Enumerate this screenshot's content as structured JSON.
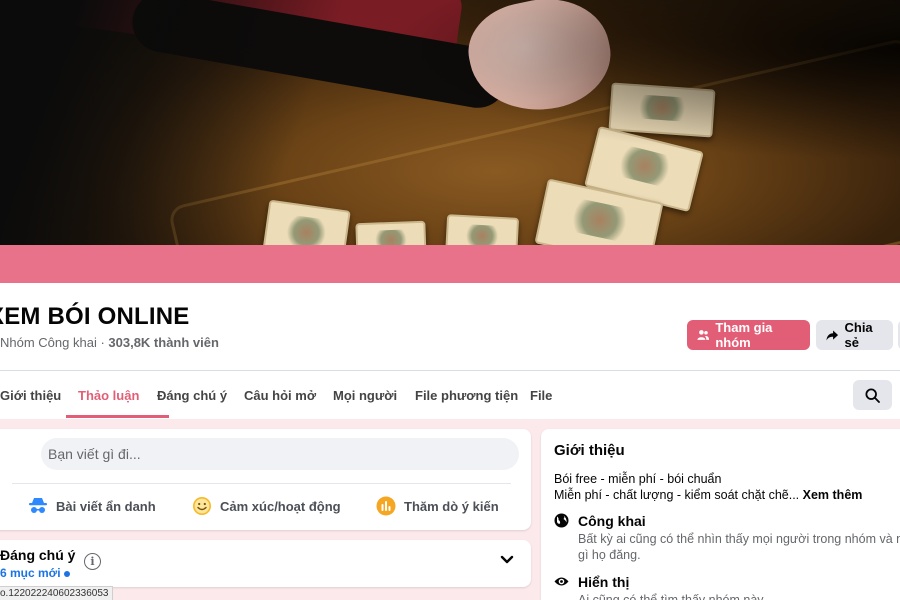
{
  "group": {
    "name": "XEM BÓI ONLINE",
    "privacy": "Nhóm Công khai",
    "separator": " · ",
    "member_count": "303,8K thành viên"
  },
  "actions": {
    "join_label": "Tham gia nhóm",
    "share_label": "Chia sẻ"
  },
  "tabs": [
    {
      "label": "Giới thiệu"
    },
    {
      "label": "Thảo luận",
      "active": true
    },
    {
      "label": "Đáng chú ý"
    },
    {
      "label": "Câu hỏi mở"
    },
    {
      "label": "Mọi người"
    },
    {
      "label": "File phương tiện"
    },
    {
      "label": "File"
    }
  ],
  "composer": {
    "placeholder": "Bạn viết gì đi...",
    "actions": [
      {
        "label": "Bài viết ẩn danh",
        "icon": "anonymous-icon",
        "color": "#2e89ff"
      },
      {
        "label": "Cảm xúc/hoạt động",
        "icon": "smiley-icon",
        "color": "#f7b928"
      },
      {
        "label": "Thăm dò ý kiến",
        "icon": "poll-icon",
        "color": "#f5a623"
      }
    ]
  },
  "featured": {
    "title": "Đáng chú ý",
    "new_items": "6 mục mới"
  },
  "intro": {
    "title": "Giới thiệu",
    "desc_line1": "Bói free - miễn phí - bói chuẩn",
    "desc_line2": "Miễn phí - chất lượng - kiểm soát chặt chẽ...",
    "see_more": "Xem thêm",
    "public_title": "Công khai",
    "public_desc_line1": "Bất kỳ ai cũng có thể nhìn thấy mọi người trong nhóm và những",
    "public_desc_line2": "gì họ đăng.",
    "visible_title": "Hiển thị",
    "visible_desc": "Ai cũng có thể tìm thấy nhóm này."
  },
  "status_url": "o.122022240602336053",
  "colors": {
    "accent": "#e25e76",
    "cover_band": "#e8728a",
    "page_bg": "#fce9ec",
    "link": "#1b74e4"
  }
}
